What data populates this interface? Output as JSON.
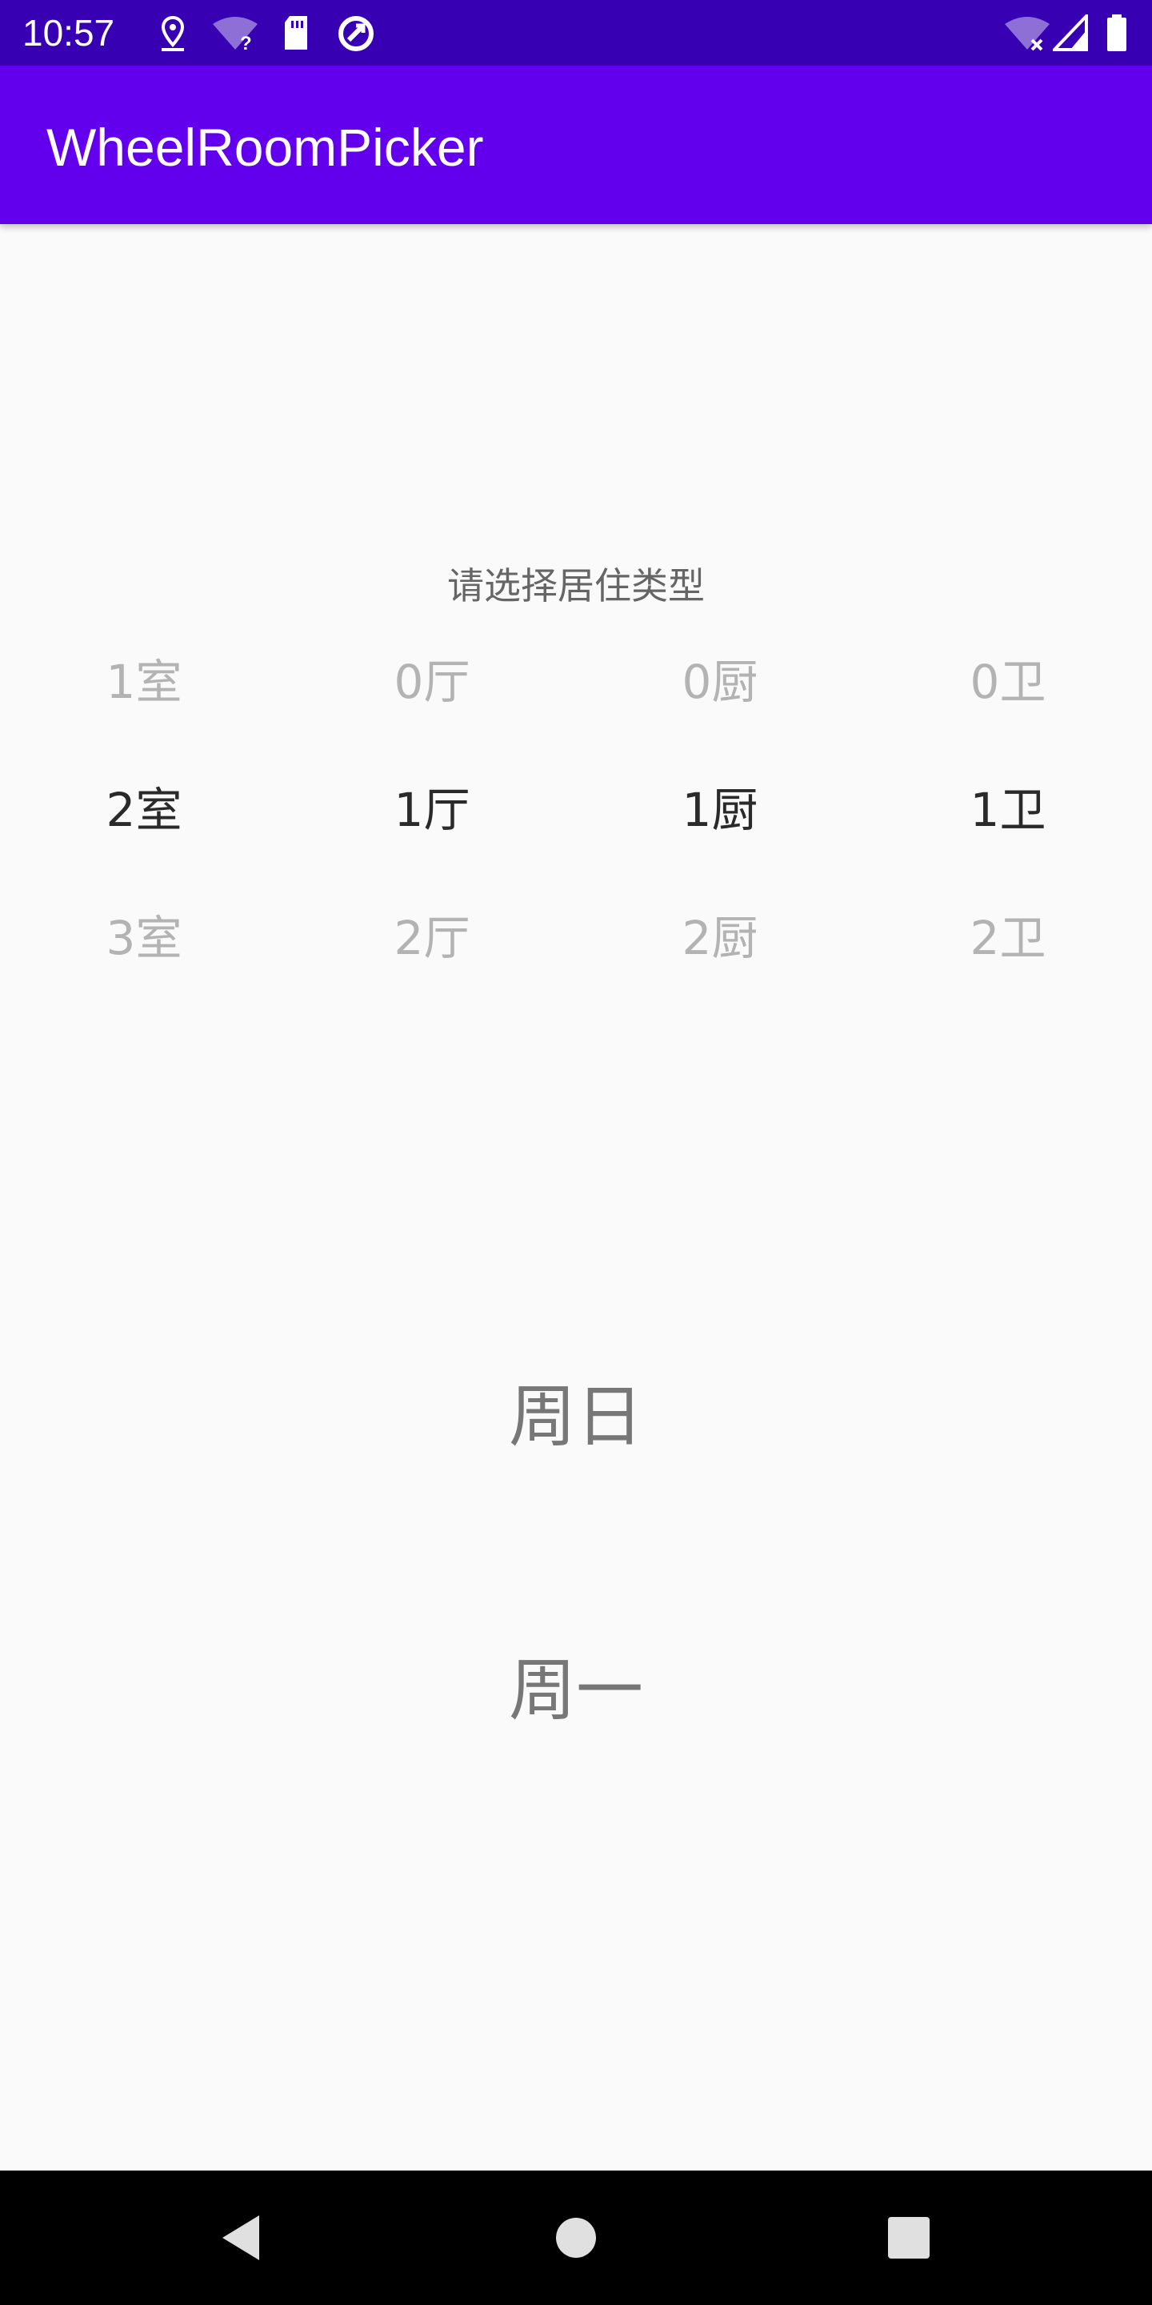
{
  "status_bar": {
    "time": "10:57",
    "icons": [
      "location-icon",
      "wifi-question-icon",
      "sd-card-icon",
      "data-saver-icon",
      "wifi-off-icon",
      "cell-signal-icon",
      "battery-icon"
    ]
  },
  "app_bar": {
    "title": "WheelRoomPicker"
  },
  "room_picker": {
    "prompt": "请选择居住类型",
    "columns": [
      {
        "items": [
          "1室",
          "2室",
          "3室"
        ],
        "selected_index": 1
      },
      {
        "items": [
          "0厅",
          "1厅",
          "2厅"
        ],
        "selected_index": 1
      },
      {
        "items": [
          "0厨",
          "1厨",
          "2厨"
        ],
        "selected_index": 1
      },
      {
        "items": [
          "0卫",
          "1卫",
          "2卫"
        ],
        "selected_index": 1
      }
    ]
  },
  "week_picker": {
    "items": [
      "周日",
      "周一"
    ]
  },
  "nav_bar": {
    "buttons": [
      "back-icon",
      "home-icon",
      "recents-icon"
    ]
  },
  "colors": {
    "status_bar": "#3700b3",
    "app_bar": "#6200ee",
    "background": "#fafafa",
    "selected_text": "#2a2a2a",
    "dim_text": "#b3b3b3"
  }
}
